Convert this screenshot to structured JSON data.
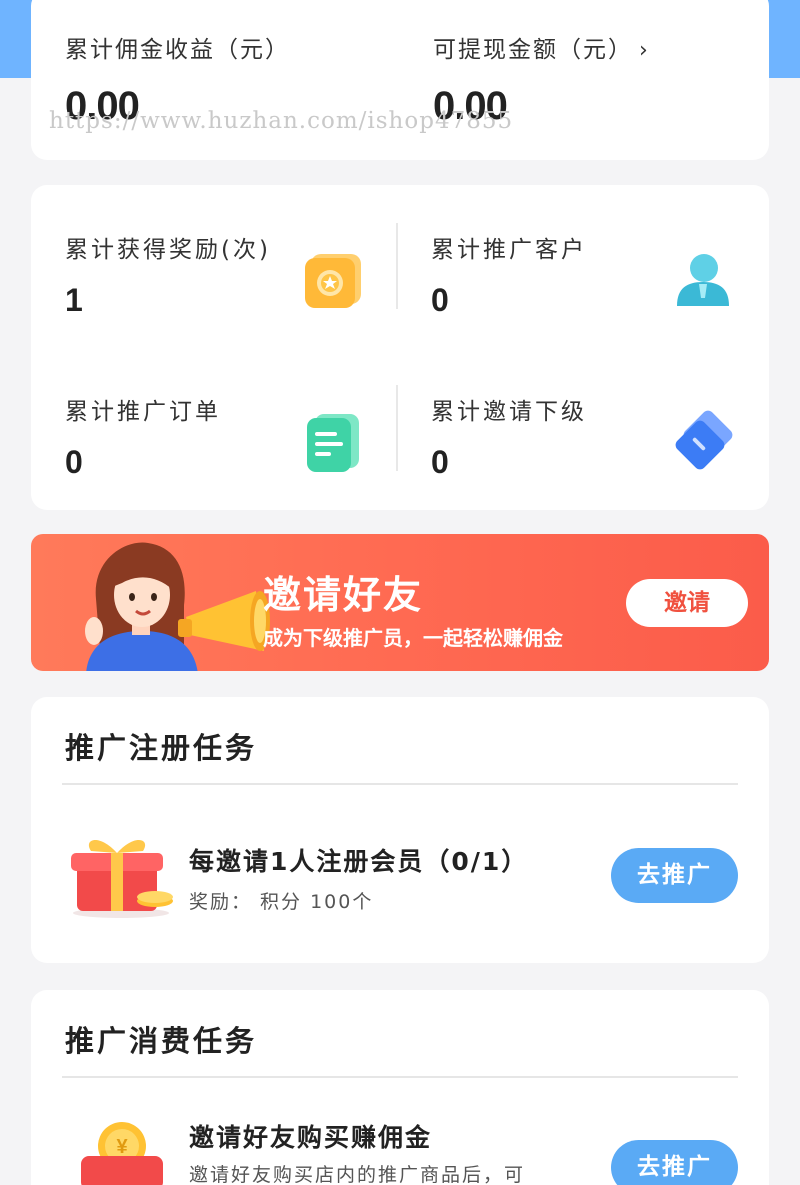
{
  "earnings": {
    "total_commission_label": "累计佣金收益（元）",
    "total_commission_value": "0.00",
    "withdrawable_label": "可提现金额（元）",
    "withdrawable_value": "0.00",
    "chevron": "›",
    "watermark": "https://www.huzhan.com/ishop47855"
  },
  "stats": [
    {
      "label": "累计获得奖励(次)",
      "value": "1",
      "icon": "coin-card-icon"
    },
    {
      "label": "累计推广客户",
      "value": "0",
      "icon": "user-icon"
    },
    {
      "label": "累计推广订单",
      "value": "0",
      "icon": "document-icon"
    },
    {
      "label": "累计邀请下级",
      "value": "0",
      "icon": "ticket-icon"
    }
  ],
  "banner": {
    "title": "邀请好友",
    "subtitle": "成为下级推广员，一起轻松赚佣金",
    "button": "邀请"
  },
  "register_task": {
    "title": "推广注册任务",
    "name": "每邀请1人注册会员（0/1）",
    "reward": "奖励： 积分 100个",
    "button": "去推广"
  },
  "consume_task": {
    "title": "推广消费任务",
    "name": "邀请好友购买赚佣金",
    "desc": "邀请好友购买店内的推广商品后，可",
    "button": "去推广"
  },
  "colors": {
    "accent_blue": "#5aaaf5",
    "banner_red": "#ff6a52",
    "header_blue": "#6fb4ff"
  }
}
